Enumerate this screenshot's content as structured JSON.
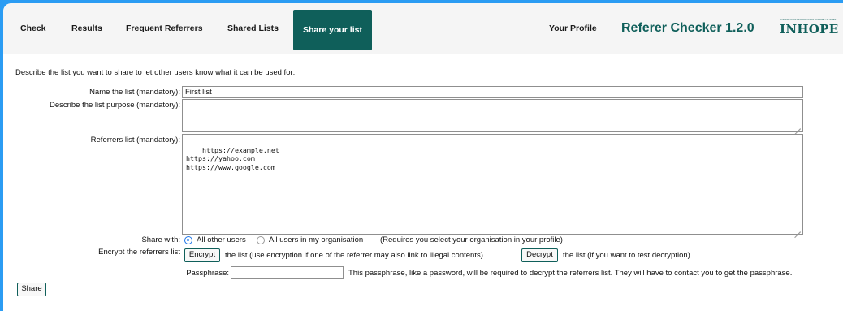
{
  "nav": {
    "items": [
      {
        "label": "Check"
      },
      {
        "label": "Results"
      },
      {
        "label": "Frequent Referrers"
      },
      {
        "label": "Shared Lists"
      },
      {
        "label": "Share your list"
      }
    ],
    "profile_label": "Your Profile",
    "app_title": "Referer Checker 1.2.0",
    "logo": {
      "tagline": "INTERNATIONAL ASSOCIATION OF INTERNET HOTLINES",
      "word": "INHOPE"
    },
    "active_color": "#0f5f5a"
  },
  "form": {
    "intro": "Describe the list you want to share to let other users know what it can be used for:",
    "name_label": "Name the list (mandatory):",
    "name_value": "First list",
    "purpose_label": "Describe the list purpose (mandatory):",
    "purpose_value": "",
    "referrers_label": "Referrers list (mandatory):",
    "referrers_value": "https://example.net\nhttps://yahoo.com\nhttps://www.google.com",
    "share_with_label": "Share with:",
    "share_options": [
      {
        "label": "All other users",
        "selected": true
      },
      {
        "label": "All users in my organisation",
        "selected": false
      }
    ],
    "share_note": "(Requires you select your organisation in your profile)",
    "encrypt_label": "Encrypt the referrers list",
    "encrypt_button": "Encrypt",
    "encrypt_note": "the list (use encryption if one of the referrer may also link to illegal contents)",
    "decrypt_button": "Decrypt",
    "decrypt_note": "the list (if you want to test decryption)",
    "passphrase_label": "Passphrase:",
    "passphrase_value": "",
    "passphrase_note": "This passphrase, like a password, will be required to decrypt the referrers list. They will have to contact you to get the passphrase.",
    "share_button": "Share"
  }
}
